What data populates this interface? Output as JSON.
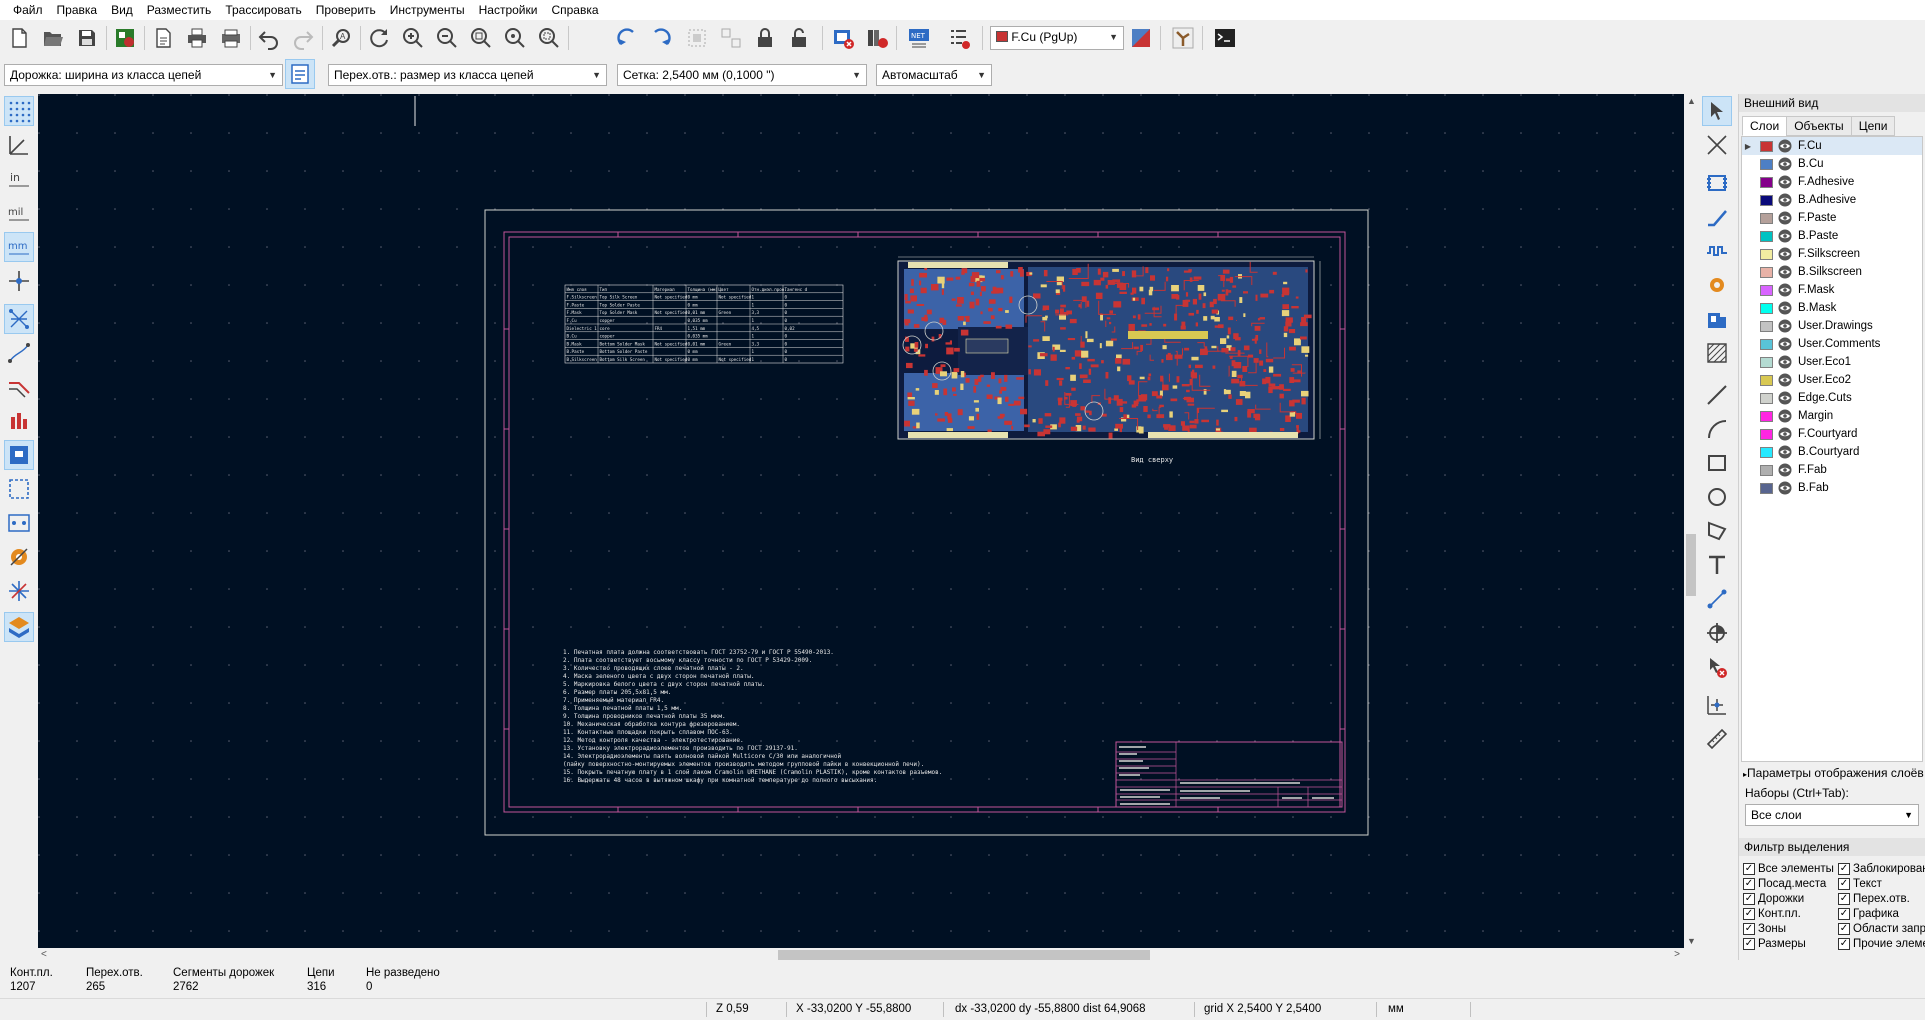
{
  "menubar": [
    "Файл",
    "Правка",
    "Вид",
    "Разместить",
    "Трассировать",
    "Проверить",
    "Инструменты",
    "Настройки",
    "Справка"
  ],
  "toolbar2": {
    "track_width": "Дорожка: ширина из класса цепей",
    "via_size": "Перех.отв.: размер из класса цепей",
    "grid": "Сетка: 2,5400 мм (0,1000 \")",
    "zoom": "Автомасштаб"
  },
  "active_layer": "F.Cu (PgUp)",
  "colors": {
    "canvas_bg": "#001023",
    "fcu": "#c83434",
    "bcu": "#4d7fc4",
    "edge": "#d0d2cd",
    "frame": "#c2549a"
  },
  "appearance": {
    "title": "Внешний вид",
    "tabs": [
      "Слои",
      "Объекты",
      "Цепи"
    ],
    "layers": [
      {
        "name": "F.Cu",
        "color": "#c83434"
      },
      {
        "name": "B.Cu",
        "color": "#4d7fc4"
      },
      {
        "name": "F.Adhesive",
        "color": "#84008a"
      },
      {
        "name": "B.Adhesive",
        "color": "#0a0a7a"
      },
      {
        "name": "F.Paste",
        "color": "#b4a09a"
      },
      {
        "name": "B.Paste",
        "color": "#00c2c2"
      },
      {
        "name": "F.Silkscreen",
        "color": "#f2eda1"
      },
      {
        "name": "B.Silkscreen",
        "color": "#e8b2a7"
      },
      {
        "name": "F.Mask",
        "color": "#d864ff"
      },
      {
        "name": "B.Mask",
        "color": "#02ffee"
      },
      {
        "name": "User.Drawings",
        "color": "#c2c2c2"
      },
      {
        "name": "User.Comments",
        "color": "#59c3d8"
      },
      {
        "name": "User.Eco1",
        "color": "#b4dbd2"
      },
      {
        "name": "User.Eco2",
        "color": "#d8c852"
      },
      {
        "name": "Edge.Cuts",
        "color": "#d0d2cd"
      },
      {
        "name": "Margin",
        "color": "#ff26e2"
      },
      {
        "name": "F.Courtyard",
        "color": "#ff26e2"
      },
      {
        "name": "B.Courtyard",
        "color": "#26e9ff"
      },
      {
        "name": "F.Fab",
        "color": "#afafaf"
      },
      {
        "name": "B.Fab",
        "color": "#58658f"
      }
    ],
    "display_options": "Параметры отображения слоёв",
    "presets_label": "Наборы (Ctrl+Tab):",
    "preset": "Все слои"
  },
  "selection_filter": {
    "title": "Фильтр выделения",
    "items": [
      "Все элементы",
      "Заблокированные",
      "Посад.места",
      "Текст",
      "Дорожки",
      "Перех.отв.",
      "Конт.пл.",
      "Графика",
      "Зоны",
      "Области запрета",
      "Размеры",
      "Прочие элементы"
    ]
  },
  "messages": [
    {
      "label": "Конт.пл.",
      "value": "1207"
    },
    {
      "label": "Перех.отв.",
      "value": "265"
    },
    {
      "label": "Сегменты дорожек",
      "value": "2762"
    },
    {
      "label": "Цепи",
      "value": "316"
    },
    {
      "label": "Не разведено",
      "value": "0"
    }
  ],
  "status": {
    "zoom": "Z 0,59",
    "xy": "X -33,0200  Y -55,8800",
    "delta": "dx -33,0200  dy -55,8800  dist 64,9068",
    "grid": "grid X 2,5400  Y 2,5400",
    "units": "мм"
  },
  "drawing": {
    "view_label": "Вид сверху",
    "notes": [
      "1. Печатная плата должна соответствовать ГОСТ 23752-79 и ГОСТ Р 55490-2013.",
      "2. Плата соответствует восьмому классу точности по ГОСТ Р 53429-2009.",
      "3. Количество проводящих слоев печатной платы - 2.",
      "4. Маска зеленого цвета с двух сторон печатной платы.",
      "5. Маркировка белого цвета с двух сторон печатной платы.",
      "6. Размер платы 205,5х81,5 мм.",
      "7. Применяемый материал FR4.",
      "8. Толщина печатной платы 1,5 мм.",
      "9. Толщина проводников печатной платы 35 мкм.",
      "10. Механическая обработка контура фрезерованием.",
      "11. Контактные площадки покрыть сплавом ПОС-63.",
      "12. Метод контроля качества - электротестирование.",
      "13. Установку электрорадиоэлементов производить по ГОСТ 29137-91.",
      "14. Электрорадиоэлементы паять волновой пайкой Multicore С/30 или аналогичной",
      "(пайку поверхностно-монтируемых элементов производить методом групповой пайки в конвекционной печи).",
      "15. Покрыть печатную плату в 1 слой лаком Cramolin URETHANE (Cramolin PLASTIK), кроме контактов разъемов.",
      "16. Выдержать 48 часов в вытяжном шкафу при комнатной температуре до полного высыхания."
    ],
    "stackup_headers": [
      "Имя слоя",
      "Тип",
      "Материал",
      "Толщина (мм)",
      "Цвет",
      "Отн.диэл.прон.",
      "Тангенс d"
    ],
    "stackup_rows": [
      [
        "F.Silkscreen",
        "Top Silk Screen",
        "Not specified",
        "0 mm",
        "Not specified",
        "1",
        "0"
      ],
      [
        "F.Paste",
        "Top Solder Paste",
        "",
        "0 mm",
        "",
        "1",
        "0"
      ],
      [
        "F.Mask",
        "Top Solder Mask",
        "Not specified",
        "0,01 mm",
        "Green",
        "3,3",
        "0"
      ],
      [
        "F.Cu",
        "copper",
        "",
        "0,035 mm",
        "",
        "1",
        "0"
      ],
      [
        "Dielectric 1",
        "core",
        "FR4",
        "1,51 mm",
        "",
        "4,5",
        "0,02"
      ],
      [
        "B.Cu",
        "copper",
        "",
        "0,035 mm",
        "",
        "1",
        "0"
      ],
      [
        "B.Mask",
        "Bottom Solder Mask",
        "Not specified",
        "0,01 mm",
        "Green",
        "3,3",
        "0"
      ],
      [
        "B.Paste",
        "Bottom Solder Paste",
        "",
        "0 mm",
        "",
        "1",
        "0"
      ],
      [
        "B.Silkscreen",
        "Bottom Silk Screen",
        "Not specified",
        "0 mm",
        "Not specified",
        "1",
        "0"
      ]
    ]
  }
}
